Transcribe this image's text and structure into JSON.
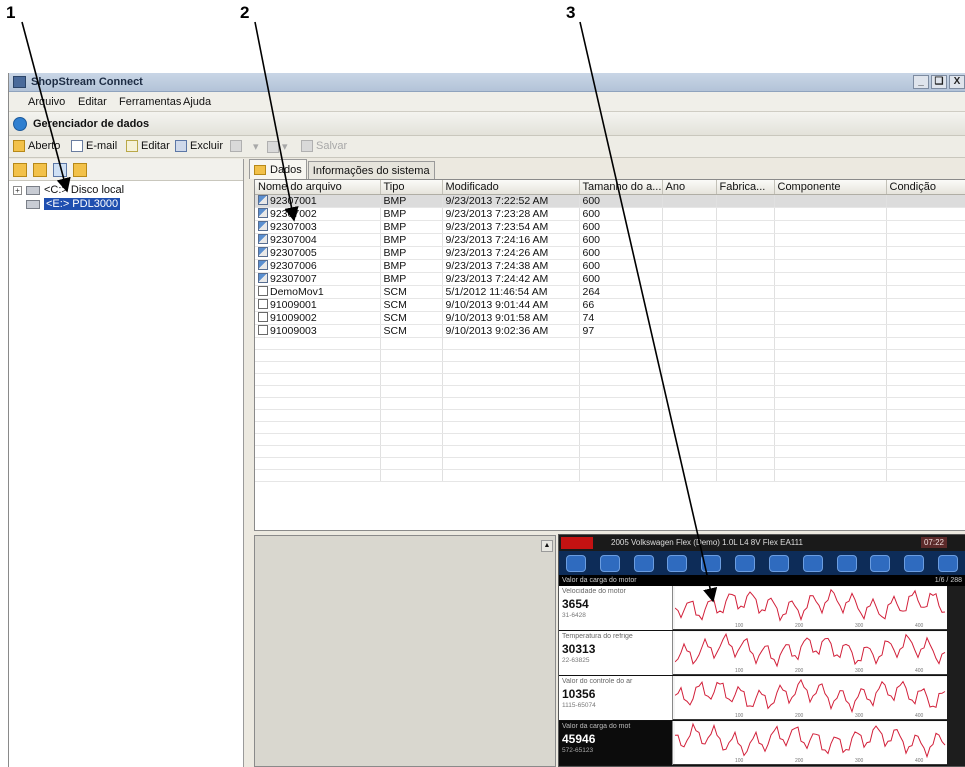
{
  "callouts": [
    "1",
    "2",
    "3"
  ],
  "window": {
    "title": "ShopStream Connect",
    "controls": [
      "_",
      "❑",
      "X"
    ]
  },
  "menu": [
    "Arquivo",
    "Editar",
    "Ferramentas",
    "Ajuda"
  ],
  "section_title": "Gerenciador de dados",
  "toolbar": {
    "open": "Aberto",
    "email": "E-mail",
    "edit": "Editar",
    "delete": "Excluir",
    "save": "Salvar"
  },
  "tree": [
    {
      "label": "<C:> Disco local",
      "selected": false
    },
    {
      "label": "<E:> PDL3000",
      "selected": true
    }
  ],
  "tabs": [
    "Dados",
    "Informações do sistema"
  ],
  "table": {
    "columns": [
      "Nome do arquivo",
      "Tipo",
      "Modificado",
      "Tamanho do a...",
      "Ano",
      "Fabrica...",
      "Componente",
      "Condição"
    ],
    "rows": [
      {
        "name": "92307001",
        "type": "BMP",
        "modified": "9/23/2013 7:22:52 AM",
        "size": "600"
      },
      {
        "name": "92307002",
        "type": "BMP",
        "modified": "9/23/2013 7:23:28 AM",
        "size": "600"
      },
      {
        "name": "92307003",
        "type": "BMP",
        "modified": "9/23/2013 7:23:54 AM",
        "size": "600"
      },
      {
        "name": "92307004",
        "type": "BMP",
        "modified": "9/23/2013 7:24:16 AM",
        "size": "600"
      },
      {
        "name": "92307005",
        "type": "BMP",
        "modified": "9/23/2013 7:24:26 AM",
        "size": "600"
      },
      {
        "name": "92307006",
        "type": "BMP",
        "modified": "9/23/2013 7:24:38 AM",
        "size": "600"
      },
      {
        "name": "92307007",
        "type": "BMP",
        "modified": "9/23/2013 7:24:42 AM",
        "size": "600"
      },
      {
        "name": "DemoMov1",
        "type": "SCM",
        "modified": "5/1/2012 11:46:54 AM",
        "size": "264"
      },
      {
        "name": "91009001",
        "type": "SCM",
        "modified": "9/10/2013 9:01:44 AM",
        "size": "66"
      },
      {
        "name": "91009002",
        "type": "SCM",
        "modified": "9/10/2013 9:01:58 AM",
        "size": "74"
      },
      {
        "name": "91009003",
        "type": "SCM",
        "modified": "9/10/2013 9:02:36 AM",
        "size": "97"
      }
    ],
    "empty_rows": 12,
    "selected_index": 0
  },
  "scanner": {
    "header": "2005 Volkswagen  Flex (Demo) 1.0L L4 8V Flex EA111",
    "time": "07:22",
    "pid_bar": "Valor da carga do motor",
    "pid_count": "1/6 / 288",
    "pids": [
      {
        "name": "Velocidade do motor",
        "value": "3654",
        "range": "31-6428",
        "dark": false
      },
      {
        "name": "Temperatura do refrige",
        "value": "30313",
        "range": "22-63825",
        "dark": false
      },
      {
        "name": "Valor do controle do ar",
        "value": "10356",
        "range": "1115-65074",
        "dark": false
      },
      {
        "name": "Valor da carga do mot",
        "value": "45946",
        "range": "572-65123",
        "dark": true
      }
    ],
    "graph_ticks": [
      "100",
      "200",
      "300",
      "400"
    ],
    "colors": {
      "header": "#1a1a1a",
      "icons_bar": "#0d2c58",
      "trace": "#d2203a"
    }
  },
  "colors": {
    "selection": "#1f4fb0",
    "row_selected": "#dcdcdc"
  }
}
